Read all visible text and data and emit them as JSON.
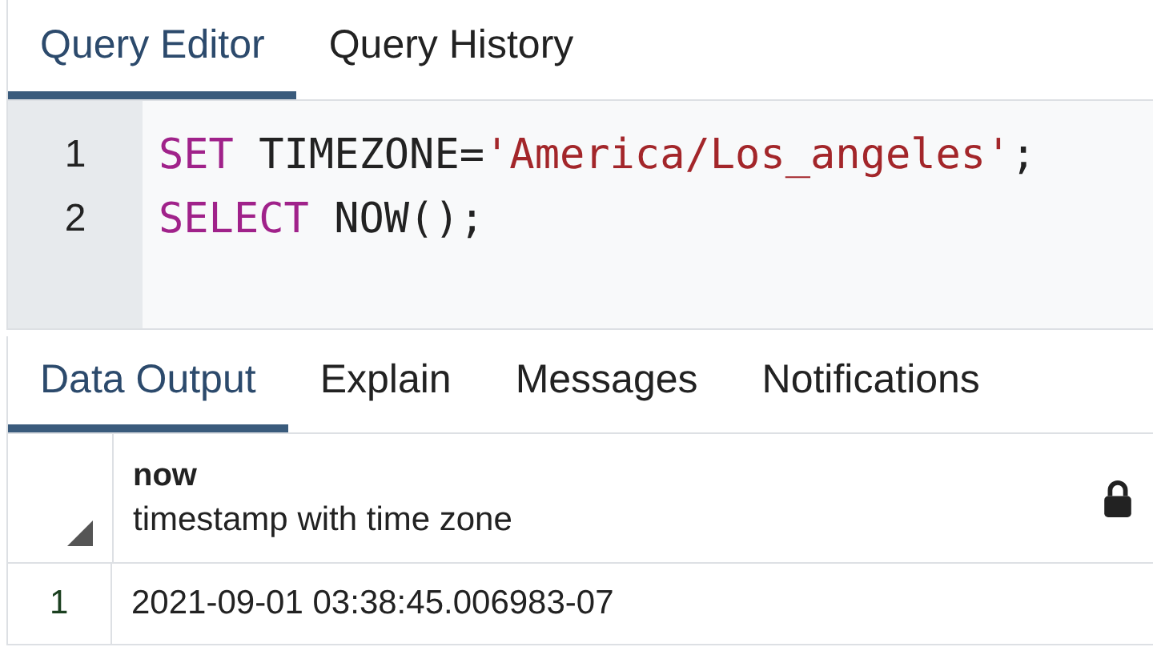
{
  "editor_tabs": [
    {
      "label": "Query Editor",
      "selected": true
    },
    {
      "label": "Query History",
      "selected": false
    }
  ],
  "code_lines": [
    {
      "number": "1",
      "tokens": [
        {
          "kind": "keyword",
          "text": "SET"
        },
        {
          "kind": "plain",
          "text": " TIMEZONE="
        },
        {
          "kind": "string",
          "text": "'America/Los_angeles'"
        },
        {
          "kind": "plain",
          "text": ";"
        }
      ]
    },
    {
      "number": "2",
      "tokens": [
        {
          "kind": "keyword",
          "text": "SELECT"
        },
        {
          "kind": "plain",
          "text": " NOW();"
        }
      ]
    }
  ],
  "output_tabs": [
    {
      "label": "Data Output",
      "selected": true
    },
    {
      "label": "Explain",
      "selected": false
    },
    {
      "label": "Messages",
      "selected": false
    },
    {
      "label": "Notifications",
      "selected": false
    }
  ],
  "table": {
    "columns": [
      {
        "name": "now",
        "type": "timestamp with time zone",
        "locked": true
      }
    ],
    "rows": [
      {
        "number": "1",
        "cells": [
          "2021-09-01 03:38:45.006983-07"
        ]
      }
    ]
  }
}
